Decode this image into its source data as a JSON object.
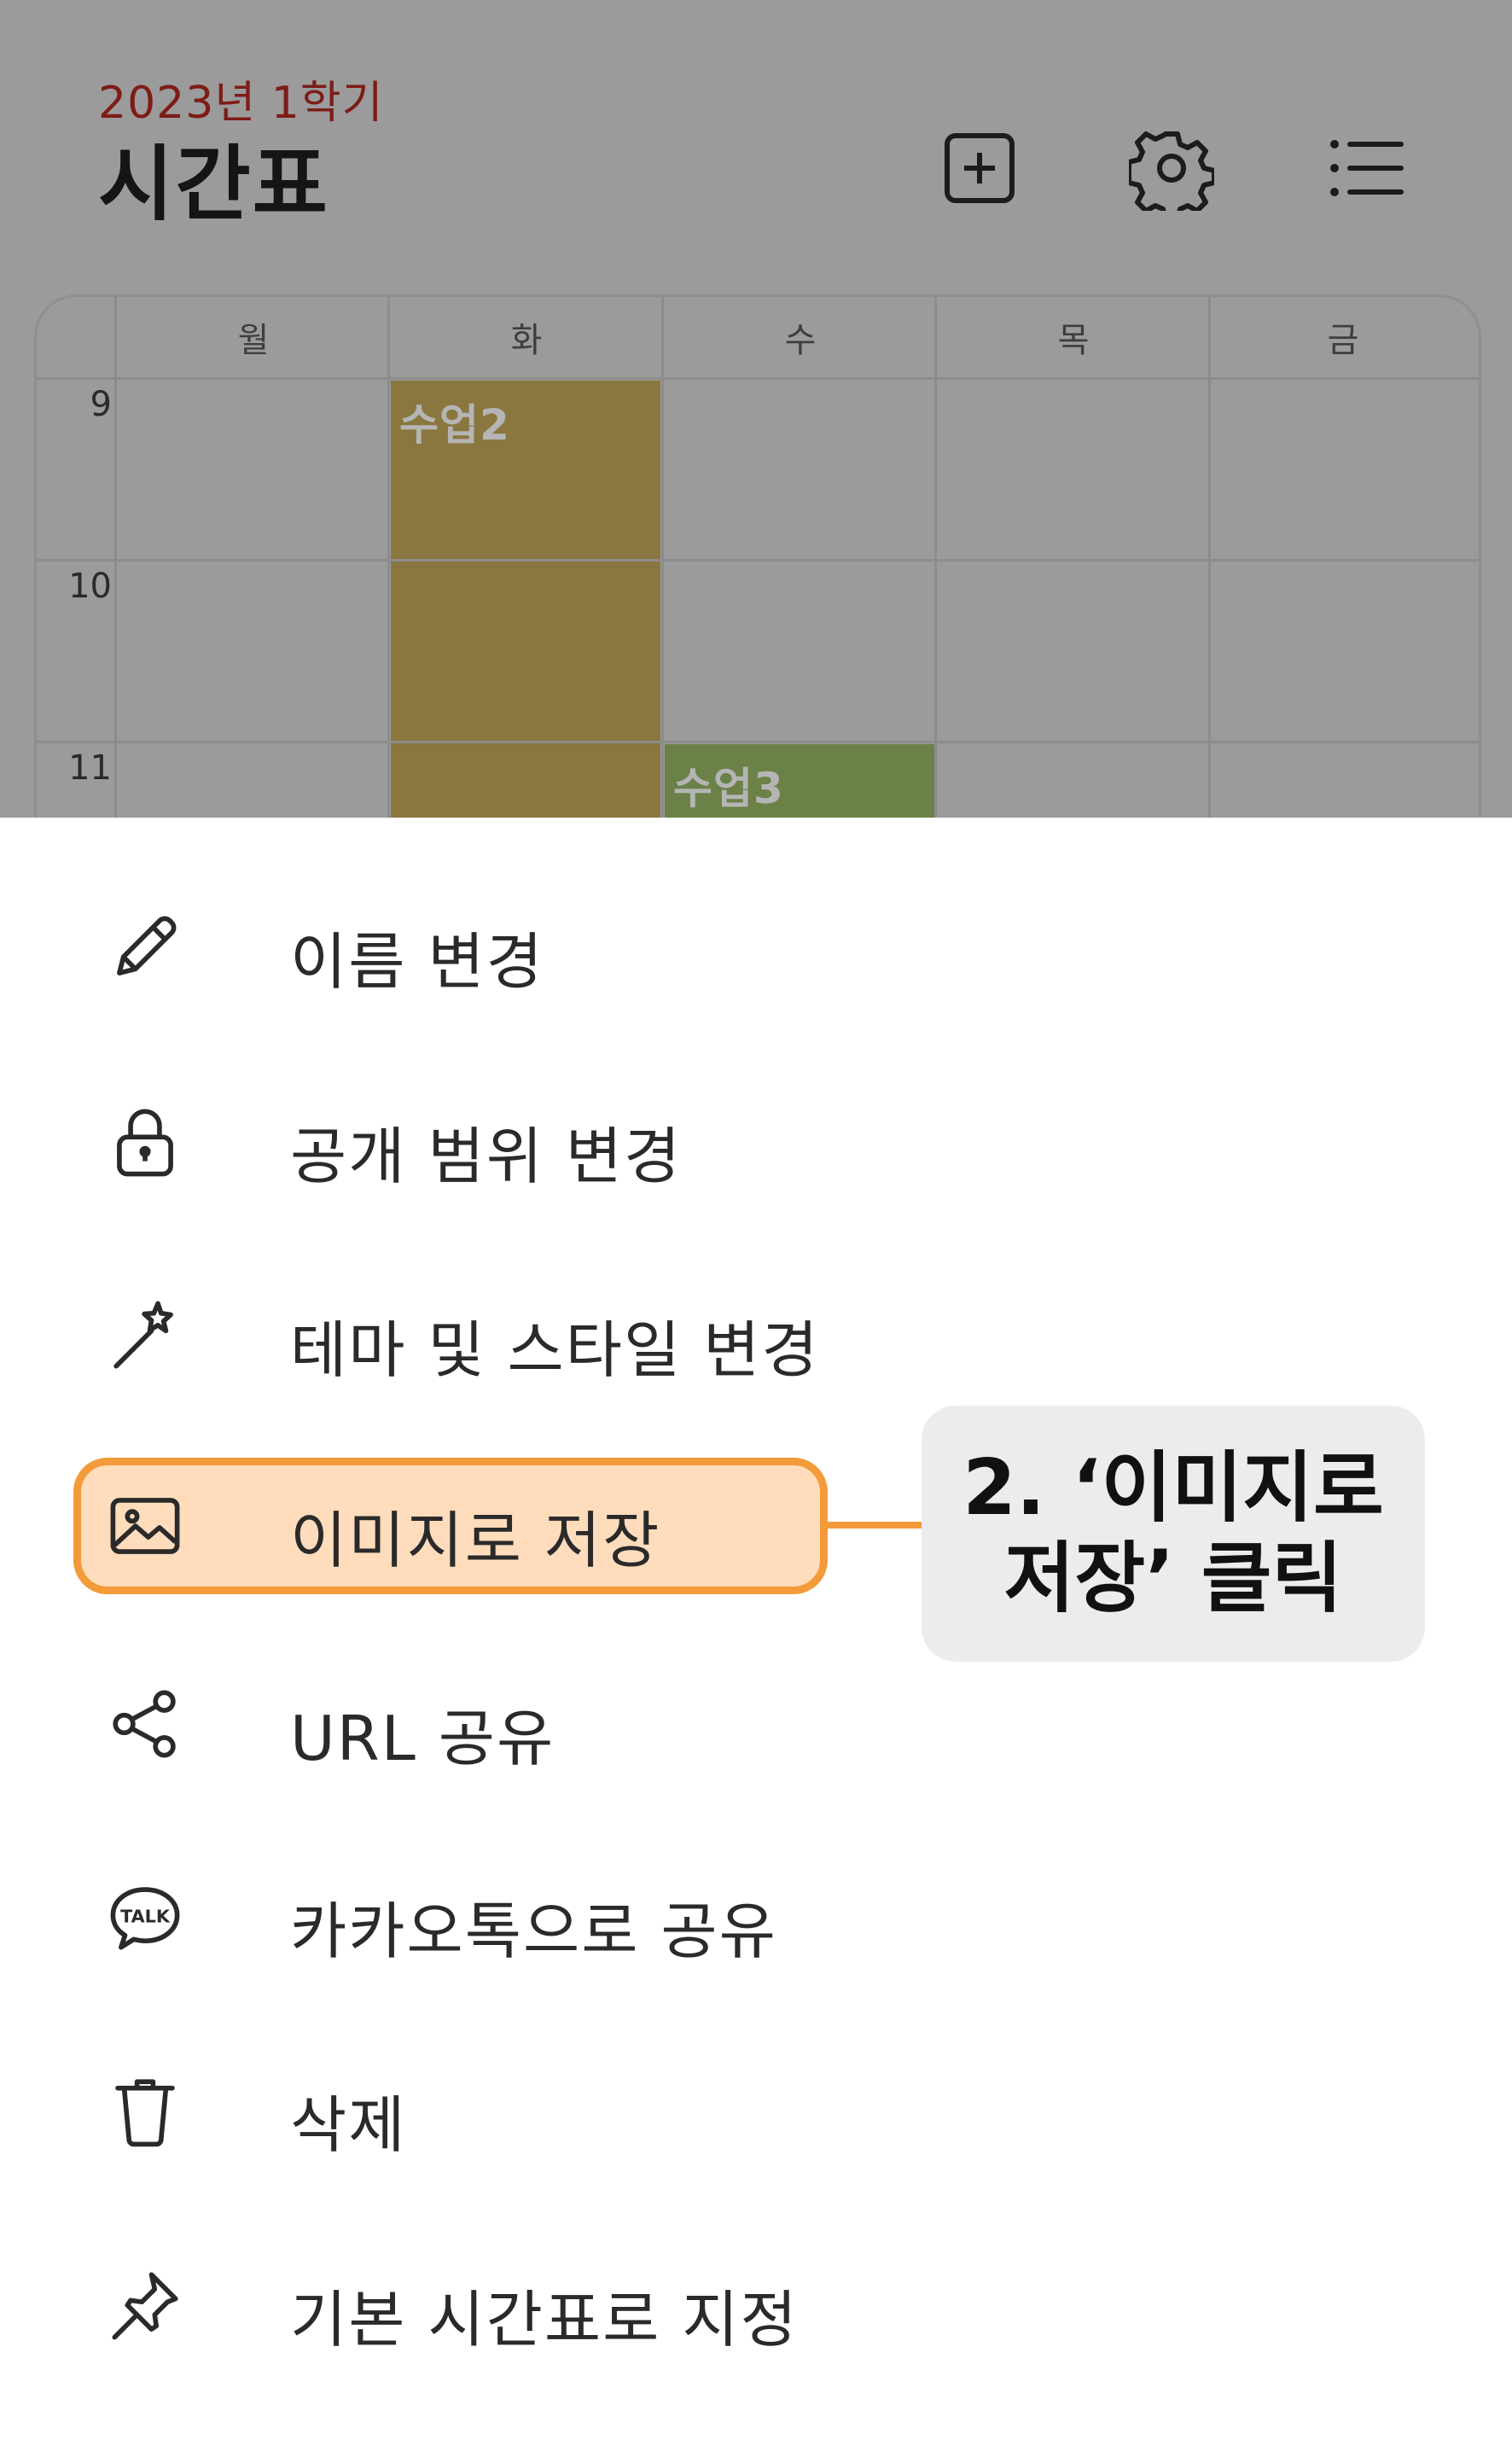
{
  "header": {
    "semester": "2023년 1학기",
    "title": "시간표",
    "icons": [
      "add-icon",
      "gear-icon",
      "list-icon"
    ]
  },
  "timetable": {
    "days": [
      "월",
      "화",
      "수",
      "목",
      "금"
    ],
    "hours": [
      "9",
      "10",
      "11"
    ],
    "classes": [
      {
        "name": "수업2",
        "day": "화",
        "start": "9",
        "color": "#8a773f"
      },
      {
        "name": "수업3",
        "day": "수",
        "start": "11",
        "color": "#6b8147"
      }
    ]
  },
  "menu": {
    "items": [
      {
        "label": "이름 변경",
        "icon": "pencil-icon"
      },
      {
        "label": "공개 범위 변경",
        "icon": "lock-icon"
      },
      {
        "label": "테마 및 스타일 변경",
        "icon": "magic-wand-icon"
      },
      {
        "label": "이미지로 저장",
        "icon": "image-icon"
      },
      {
        "label": "URL 공유",
        "icon": "share-icon"
      },
      {
        "label": "카카오톡으로 공유",
        "icon": "kakaotalk-icon"
      },
      {
        "label": "삭제",
        "icon": "trash-icon"
      },
      {
        "label": "기본 시간표로 지정",
        "icon": "pin-icon"
      }
    ]
  },
  "annotation": {
    "line1": "2. ‘이미지로",
    "line2": "저장’ 클릭",
    "color": "#f39a3a"
  }
}
